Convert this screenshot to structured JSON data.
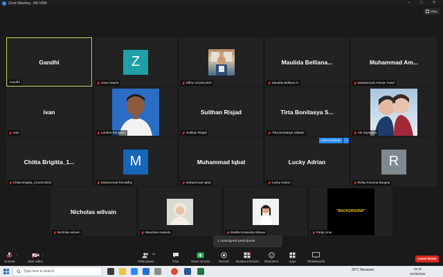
{
  "window": {
    "title": "Zoom Meeting - AA-VRM",
    "view_label": "View"
  },
  "tiles": [
    {
      "name": "Gandhi",
      "label": "Gandhi",
      "kind": "name",
      "active": true
    },
    {
      "name": "",
      "label": "zoom baa04",
      "kind": "letter",
      "letter": "Z",
      "color": "#1ea0a6"
    },
    {
      "name": "",
      "label": "Elfira-1211913037",
      "kind": "photo"
    },
    {
      "name": "Maulida Belliana...",
      "label": "Maulida Belliana P.",
      "kind": "name"
    },
    {
      "name": "Muhammad Am...",
      "label": "Muhammad Ammar Yusuf",
      "kind": "name"
    },
    {
      "name": "ivan",
      "label": "ivan",
      "kind": "name"
    },
    {
      "name": "",
      "label": "Lambot Panjaitan",
      "kind": "photo"
    },
    {
      "name": "Sulthan Risjad",
      "label": "Sulthan Risjad",
      "kind": "name"
    },
    {
      "name": "Tirta Bonitasya S...",
      "label": "Tirta Bonitasya Silalahi",
      "kind": "name"
    },
    {
      "name": "",
      "label": "Aik Septyana",
      "kind": "photo"
    },
    {
      "name": "Chitta Brigitta_1...",
      "label": "Chitta Brigitta_1211913042",
      "kind": "name"
    },
    {
      "name": "",
      "label": "Muhammad Renaldhy",
      "kind": "letter",
      "letter": "M",
      "color": "#1565b8"
    },
    {
      "name": "Muhammad Iqbal",
      "label": "Muhammad Iqbal",
      "kind": "name"
    },
    {
      "name": "Lucky Adrian",
      "label": "Lucky Adrian",
      "kind": "name"
    },
    {
      "name": "",
      "label": "Rizky Kesuma Bangsa",
      "kind": "letter",
      "letter": "R",
      "color": "#7d8a8f"
    },
    {
      "name": "Nicholas wilvain",
      "label": "Nicholas wilvain",
      "kind": "name"
    },
    {
      "name": "",
      "label": "Mauriska Awanda",
      "kind": "photo"
    },
    {
      "name": "",
      "label": "Desilla Krissanta Sibuea",
      "kind": "photo"
    },
    {
      "name": "",
      "label": "Fenly Linar",
      "kind": "photo",
      "overlay_text": "\"BACKGROUND\""
    }
  ],
  "ask_to_unmute": "Ask to Unmute",
  "ask_more": "...",
  "toast": "1 unassigned participants",
  "toolbar": {
    "unmute": "Unmute",
    "start_video": "Start Video",
    "participants": "Participants",
    "participants_count": "19",
    "chat": "Chat",
    "share_screen": "Share Screen",
    "record": "Record",
    "breakout_rooms": "Breakout Rooms",
    "reactions": "Reactions",
    "apps": "Apps",
    "whiteboards": "Whiteboards",
    "leave": "Leave Room"
  },
  "taskbar": {
    "search_placeholder": "Type here to search",
    "weather": "25°C  Berawan",
    "time": "19:15",
    "date": "31/05/2022"
  }
}
